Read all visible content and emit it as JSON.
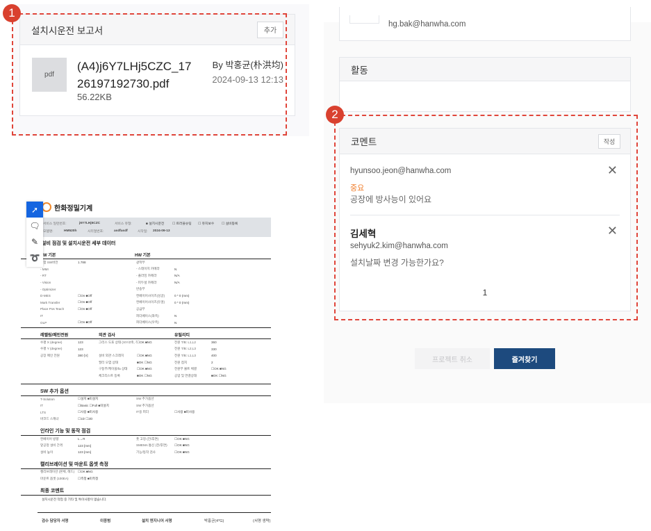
{
  "report": {
    "title": "설치시운전 보고서",
    "add_label": "추가",
    "file_type": "pdf",
    "file_name_1": "(A4)j6Y7LHj5CZC_17",
    "file_name_2": "26197192730.pdf",
    "file_size": "56.22KB",
    "author": "By 박홍균(朴洪均)",
    "date": "2024-09-13 12:13"
  },
  "markers": [
    "1",
    "2"
  ],
  "contact": {
    "email": "hg.bak@hanwha.com"
  },
  "activity": {
    "title": "활동"
  },
  "comments": {
    "title": "코멘트",
    "write_label": "작성",
    "items": [
      {
        "name": "",
        "email": "hyunsoo.jeon@hanwha.com",
        "tag": "중요",
        "text": "공장에 방사능이 있어요"
      },
      {
        "name": "김세혁",
        "email": "sehyuk2.kim@hanwha.com",
        "tag": "",
        "text": "설치날짜 변경 가능한가요?"
      }
    ],
    "page": "1"
  },
  "actions": {
    "cancel": "프로젝트 취소",
    "favorite": "즐겨찾기"
  },
  "colors": {
    "accent": "#1d4a7e",
    "marker": "#d9412f",
    "tag": "#f07c2a"
  },
  "document": {
    "company": "한화정밀기계",
    "info1": [
      "서비스 일련번호:",
      "j6Y7LHj5CZC",
      "서비스 유형:",
      "■ 설치시운전",
      "☐ 트러블슈팅",
      "☐ 유지보수",
      "☐ 설비등록"
    ],
    "info2": [
      "모델명:",
      "HM520h",
      "시리얼번호:",
      "asdfasdf",
      "시작일:",
      "2024-09-13"
    ],
    "title": "설비 점검 및 설치시운전 세부 데이터",
    "sw_head": "SW 기본",
    "hw_head": "HW 기본",
    "basic_rows": [
      [
        "통합 SW버전",
        "1.788",
        "광학부",
        ""
      ],
      [
        "- MMI",
        "",
        "- 스테이지 카메라",
        "N"
      ],
      [
        "- RT",
        "",
        "- 플라잉 카메라",
        "N/A"
      ],
      [
        "- Vision",
        "",
        "- 피두셜 카메라",
        "N/A"
      ],
      [
        "- Optimizer",
        "",
        "반송부",
        ""
      ],
      [
        "D-MES",
        "☐On ■Off",
        "컨베이어사이즈(싱글)",
        "0 * 0 (mm)"
      ],
      [
        "Mark Transfer",
        "☐On ■Off",
        "컨베이어사이즈(듀얼)",
        "0 * 0 (mm)"
      ],
      [
        "Place Pos Teach",
        "☐On ■Off",
        "공급부",
        ""
      ],
      [
        "IT",
        "",
        "피더베이스(좌측)",
        "N"
      ],
      [
        "OLP",
        "☐On ■Off",
        "피더베이스(우측)",
        "N"
      ]
    ],
    "heads3": [
      "레벨링/메인전원",
      "외관 검사",
      "유틸리티"
    ],
    "rows3": [
      [
        "수평 X (degree)",
        "123",
        "그리스 도포 상태 (X/Y/Z축, 헤드)",
        "☐OK ■NG",
        "전원 T/B: L1,L2",
        "360"
      ],
      [
        "수평 Y (degree)",
        "123",
        "",
        "",
        "전원 T/B: L2,L3",
        "330"
      ],
      [
        "공장 메인 전원",
        "380 [V]",
        "설비 외관 스크래치",
        "☐OK ■NG",
        "전원 T/B: L1,L3",
        "400"
      ],
      [
        "",
        "",
        "필터 오염 상태",
        "■OK ☐NG",
        "전원 접지",
        "2"
      ],
      [
        "",
        "",
        "구동부/케이블/fa 상태",
        "☐OK ■NG",
        "전원부 볼트 체결",
        "☐OK ■NG"
      ],
      [
        "",
        "",
        "체크리스트 등록",
        "■OK ☐NG",
        "공압 및 연결상태",
        "■OK ☐NG"
      ]
    ],
    "sw_opt_head": "SW 추가 옵션",
    "sw_opt_rows": [
      [
        "T-Solution",
        "☐설치 ■미설치",
        "SW 추가옵션",
        ""
      ],
      [
        "IT",
        "☐Basic ☐Full ■미설치",
        "SW 추가옵션",
        ""
      ],
      [
        "LTS",
        "☐사용 ■미사용",
        "IT용 피더",
        "☐사용 ■미사용"
      ],
      [
        "바코드 스캐너",
        "☐1D ☐2D",
        "",
        ""
      ]
    ],
    "inline_head": "인라인 기능 및 동작 점검",
    "inline_rows": [
      [
        "컨베이어 방향",
        "L→R",
        "풋 고정 (전/후면)",
        "☐OK ■NG"
      ],
      [
        "앞공정 설비 간격",
        "123 [mm]",
        "SMEMA 통신 (전/후면)",
        "☐OK ■NG"
      ],
      [
        "설비 높이",
        "123 [mm]",
        "기능/동작 검사",
        "☐OK ■NG"
      ]
    ],
    "calib_head": "캘리브레이션 및 마운트 옵셋 측정",
    "calib_rows": [
      [
        "캘리브레이션 (본체, 헤드)",
        "☐OK ■NG",
        "",
        ""
      ],
      [
        "마운트 옵셋 (100EA)",
        "☐측정 ■미측정",
        "",
        ""
      ]
    ],
    "final_head": "최종 코멘트",
    "final_text": "설치시운전 작업 중 기타 및 특이사항이 없습니다.",
    "sign": [
      "검수 담당자 서명",
      "이종범",
      "설치 엔지니어 서명",
      "박홍균(4*G)",
      "(서명 생략)"
    ]
  }
}
